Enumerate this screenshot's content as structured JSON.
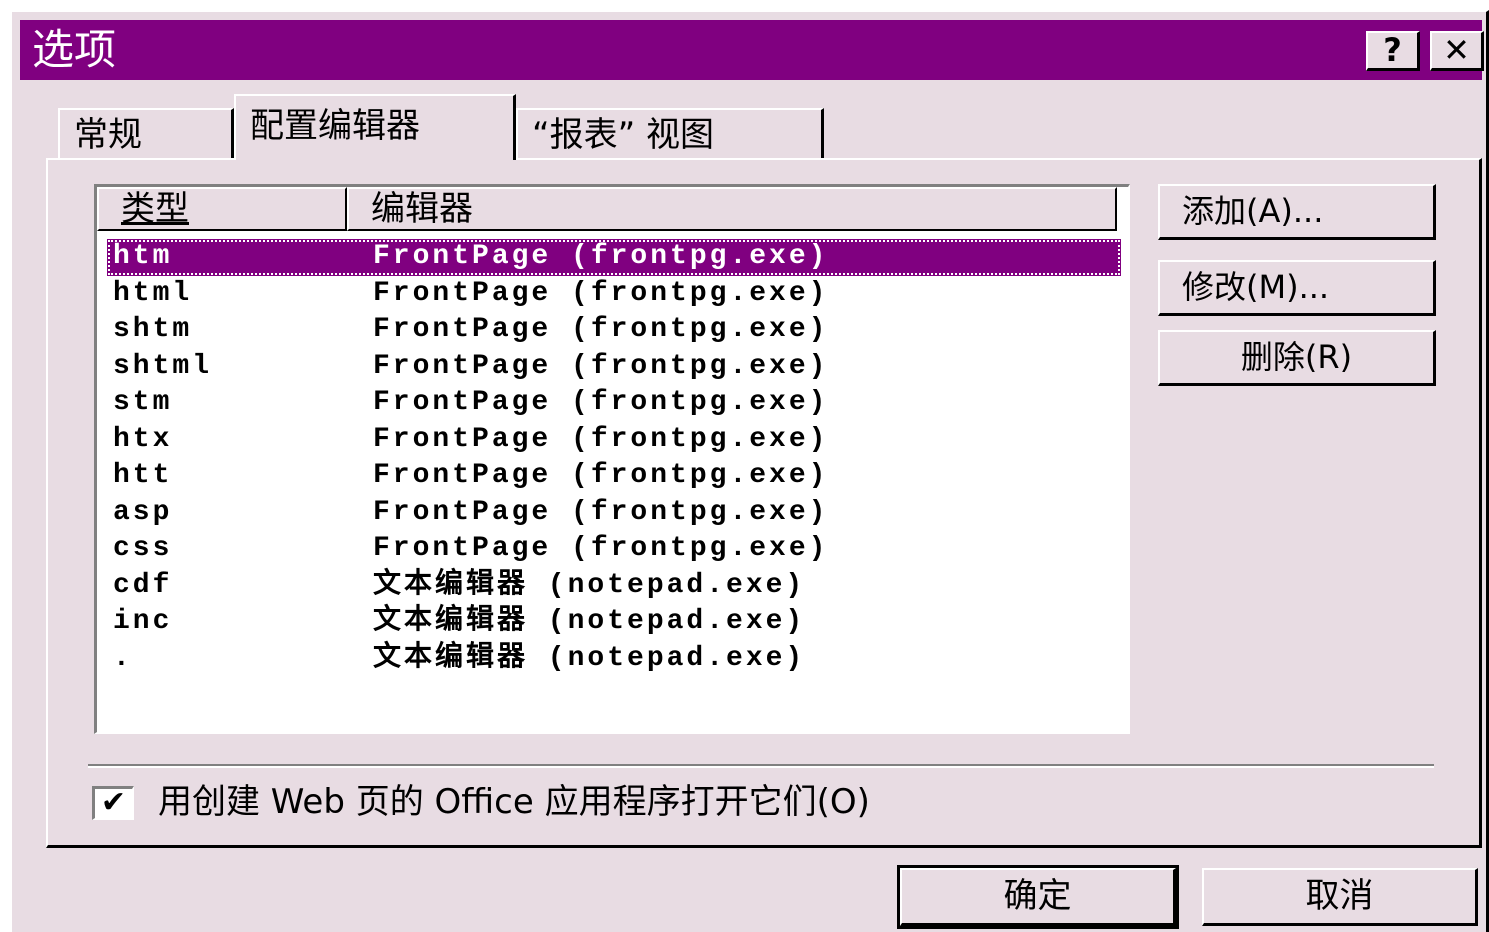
{
  "window": {
    "title": "选项",
    "help_label": "?",
    "close_label": "✕"
  },
  "tabs": [
    {
      "label": "常规"
    },
    {
      "label": "配置编辑器"
    },
    {
      "label": "“报表” 视图"
    }
  ],
  "list": {
    "columns": {
      "type": "类型",
      "editor": "编辑器"
    },
    "rows": [
      {
        "type": "htm",
        "editor": "FrontPage (frontpg.exe)"
      },
      {
        "type": "html",
        "editor": "FrontPage (frontpg.exe)"
      },
      {
        "type": "shtm",
        "editor": "FrontPage (frontpg.exe)"
      },
      {
        "type": "shtml",
        "editor": "FrontPage (frontpg.exe)"
      },
      {
        "type": "stm",
        "editor": "FrontPage (frontpg.exe)"
      },
      {
        "type": "htx",
        "editor": "FrontPage (frontpg.exe)"
      },
      {
        "type": "htt",
        "editor": "FrontPage (frontpg.exe)"
      },
      {
        "type": "asp",
        "editor": "FrontPage (frontpg.exe)"
      },
      {
        "type": "css",
        "editor": "FrontPage (frontpg.exe)"
      },
      {
        "type": "cdf",
        "editor": "文本编辑器 (notepad.exe)"
      },
      {
        "type": "inc",
        "editor": "文本编辑器 (notepad.exe)"
      },
      {
        "type": ".",
        "editor": "文本编辑器 (notepad.exe)"
      }
    ]
  },
  "side_buttons": {
    "add": "添加(A)...",
    "modify": "修改(M)...",
    "delete": "删除(R)"
  },
  "option": {
    "checked_mark": "✔",
    "label": "用创建 Web 页的 Office 应用程序打开它们(O)"
  },
  "footer": {
    "ok": "确定",
    "cancel": "取消"
  },
  "colors": {
    "titlebar": "#800080",
    "selection": "#800080",
    "face": "#e8dce3"
  }
}
